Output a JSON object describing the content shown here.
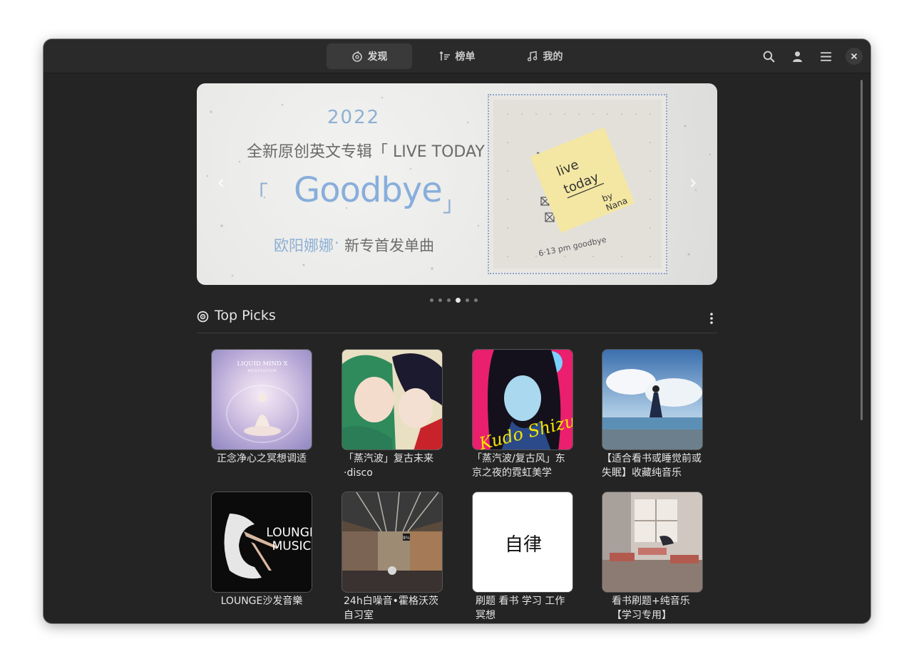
{
  "header": {
    "tabs": [
      {
        "label": "发现",
        "icon": "discover-icon",
        "active": true
      },
      {
        "label": "榜单",
        "icon": "chart-icon",
        "active": false
      },
      {
        "label": "我的",
        "icon": "music-note-icon",
        "active": false
      }
    ],
    "actions": [
      "search-icon",
      "user-icon",
      "menu-icon",
      "close-icon"
    ]
  },
  "banner": {
    "year": "2022",
    "line1": "全新原创英文专辑「 LIVE TODAY 」",
    "bracket_left": "「",
    "bracket_right": "」",
    "title": "Goodbye",
    "artist": "欧阳娜娜",
    "dot": "·",
    "subtitle": "新专首发单曲",
    "note_line1": "live",
    "note_line2": "today",
    "note_by": "by",
    "note_name": "Nana",
    "note_caption": "6·13 pm goodbye",
    "page_count": 6,
    "active_page": 4
  },
  "top_picks": {
    "title": "Top Picks",
    "items": [
      {
        "title": "正念净心之冥想调适"
      },
      {
        "title": "「蒸汽波」复古未来·disco"
      },
      {
        "title": "「蒸汽波/复古风」东京之夜的霓虹美学"
      },
      {
        "title": "【适合看书或睡觉前或失眠】收藏纯音乐"
      },
      {
        "title": "LOUNGE沙发音樂"
      },
      {
        "title": "24h白噪音•霍格沃茨自习室"
      },
      {
        "title": "刷题 看书 学习 工作冥想"
      },
      {
        "title": "看书刷题+纯音乐【学习专用】"
      }
    ],
    "cover_texts": {
      "c1_line1": "LIQUID MIND X",
      "c1_line2": "MEDITATION",
      "c3_script": "Kudo Shizuka",
      "c5_line1": "LOUNGE",
      "c5_line2": "MUSIC",
      "c6_sign": "9¾",
      "c7_text": "自律"
    }
  },
  "colors": {
    "window_bg": "#242424",
    "header_bg": "#2a2a2a",
    "accent_blue": "#88aedb"
  }
}
